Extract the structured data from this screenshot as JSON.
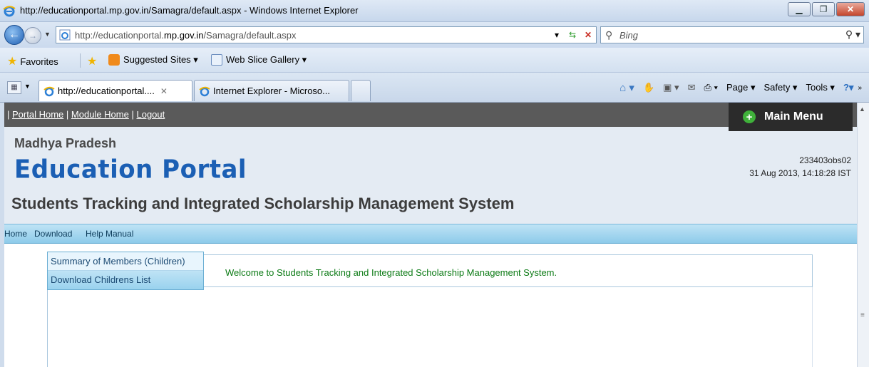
{
  "window": {
    "title": "http://educationportal.mp.gov.in/Samagra/default.aspx - Windows Internet Explorer",
    "controls": [
      "minimize",
      "maximize",
      "close"
    ]
  },
  "address_bar": {
    "url_prefix": "http://educationportal.",
    "url_domain": "mp.gov.in",
    "url_suffix": "/Samagra/default.aspx",
    "search_placeholder": "Bing"
  },
  "favorites_bar": {
    "favorites_label": "Favorites",
    "suggested_sites": "Suggested Sites ▾",
    "web_slice": "Web Slice Gallery ▾"
  },
  "tabs": [
    {
      "label": "http://educationportal....",
      "active": true
    },
    {
      "label": "Internet Explorer - Microso...",
      "active": false
    }
  ],
  "command_bar": {
    "page": "Page ▾",
    "safety": "Safety ▾",
    "tools": "Tools ▾"
  },
  "portal": {
    "top_links": {
      "sep": "|",
      "portal_home": "Portal Home",
      "module_home": "Module Home",
      "logout": "Logout"
    },
    "main_menu": "Main Menu",
    "state": "Madhya Pradesh",
    "brand": "Education Portal",
    "user_id": "233403obs02",
    "datetime": "31 Aug 2013, 14:18:28 IST",
    "system_title": "Students Tracking and Integrated Scholarship Management System",
    "menu": {
      "home": "Home",
      "download": "Download",
      "help_manual": "Help Manual"
    },
    "submenu": {
      "summary": "Summary of Members (Children)",
      "download_list": "Download Childrens List"
    },
    "welcome": "Welcome to Students Tracking and Integrated Scholarship Management System."
  },
  "colors": {
    "brand_blue": "#1b5fb4",
    "welcome_green": "#0b7a14",
    "topnav_gray": "#5a5a5a",
    "menubar_blue": "#8dcbea"
  }
}
